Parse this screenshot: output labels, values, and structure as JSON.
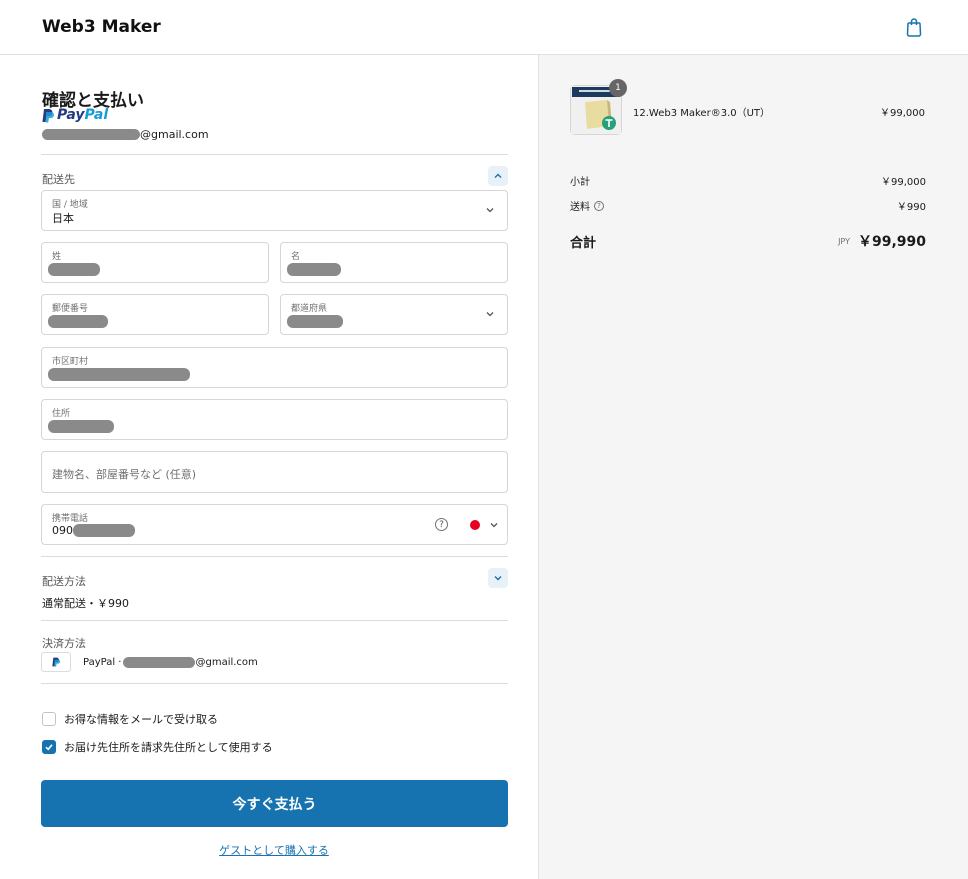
{
  "header": {
    "brand": "Web3 Maker"
  },
  "checkout": {
    "title": "確認と支払い",
    "paypal_pay": "Pay",
    "paypal_pal": "Pal",
    "email_suffix": "@gmail.com"
  },
  "shipping": {
    "section_label": "配送先",
    "country_label": "国 / 地域",
    "country_value": "日本",
    "last_name_label": "姓",
    "first_name_label": "名",
    "postal_label": "郵便番号",
    "prefecture_label": "都道府県",
    "city_label": "市区町村",
    "address_label": "住所",
    "building_placeholder": "建物名、部屋番号など (任意)",
    "phone_label": "携帯電話",
    "phone_prefix": "090-"
  },
  "delivery": {
    "section_label": "配送方法",
    "value": "通常配送・￥990"
  },
  "payment": {
    "section_label": "決済方法",
    "method_prefix": "PayPal ·",
    "email_suffix": "@gmail.com"
  },
  "options": {
    "newsletter": {
      "label": "お得な情報をメールで受け取る",
      "checked": false
    },
    "billing_same": {
      "label": "お届け先住所を請求先住所として使用する",
      "checked": true
    }
  },
  "pay_button": "今すぐ支払う",
  "guest_link": "ゲストとして購入する",
  "summary": {
    "item": {
      "name": "12.Web3 Maker®3.0（UT）",
      "price": "￥99,000",
      "quantity": "1"
    },
    "subtotal_label": "小計",
    "subtotal_value": "￥99,000",
    "shipping_label": "送料",
    "shipping_value": "￥990",
    "total_label": "合計",
    "currency": "JPY",
    "total_value": "￥99,990"
  },
  "colors": {
    "accent": "#1773b0",
    "summary_bg": "#f5f5f5"
  }
}
